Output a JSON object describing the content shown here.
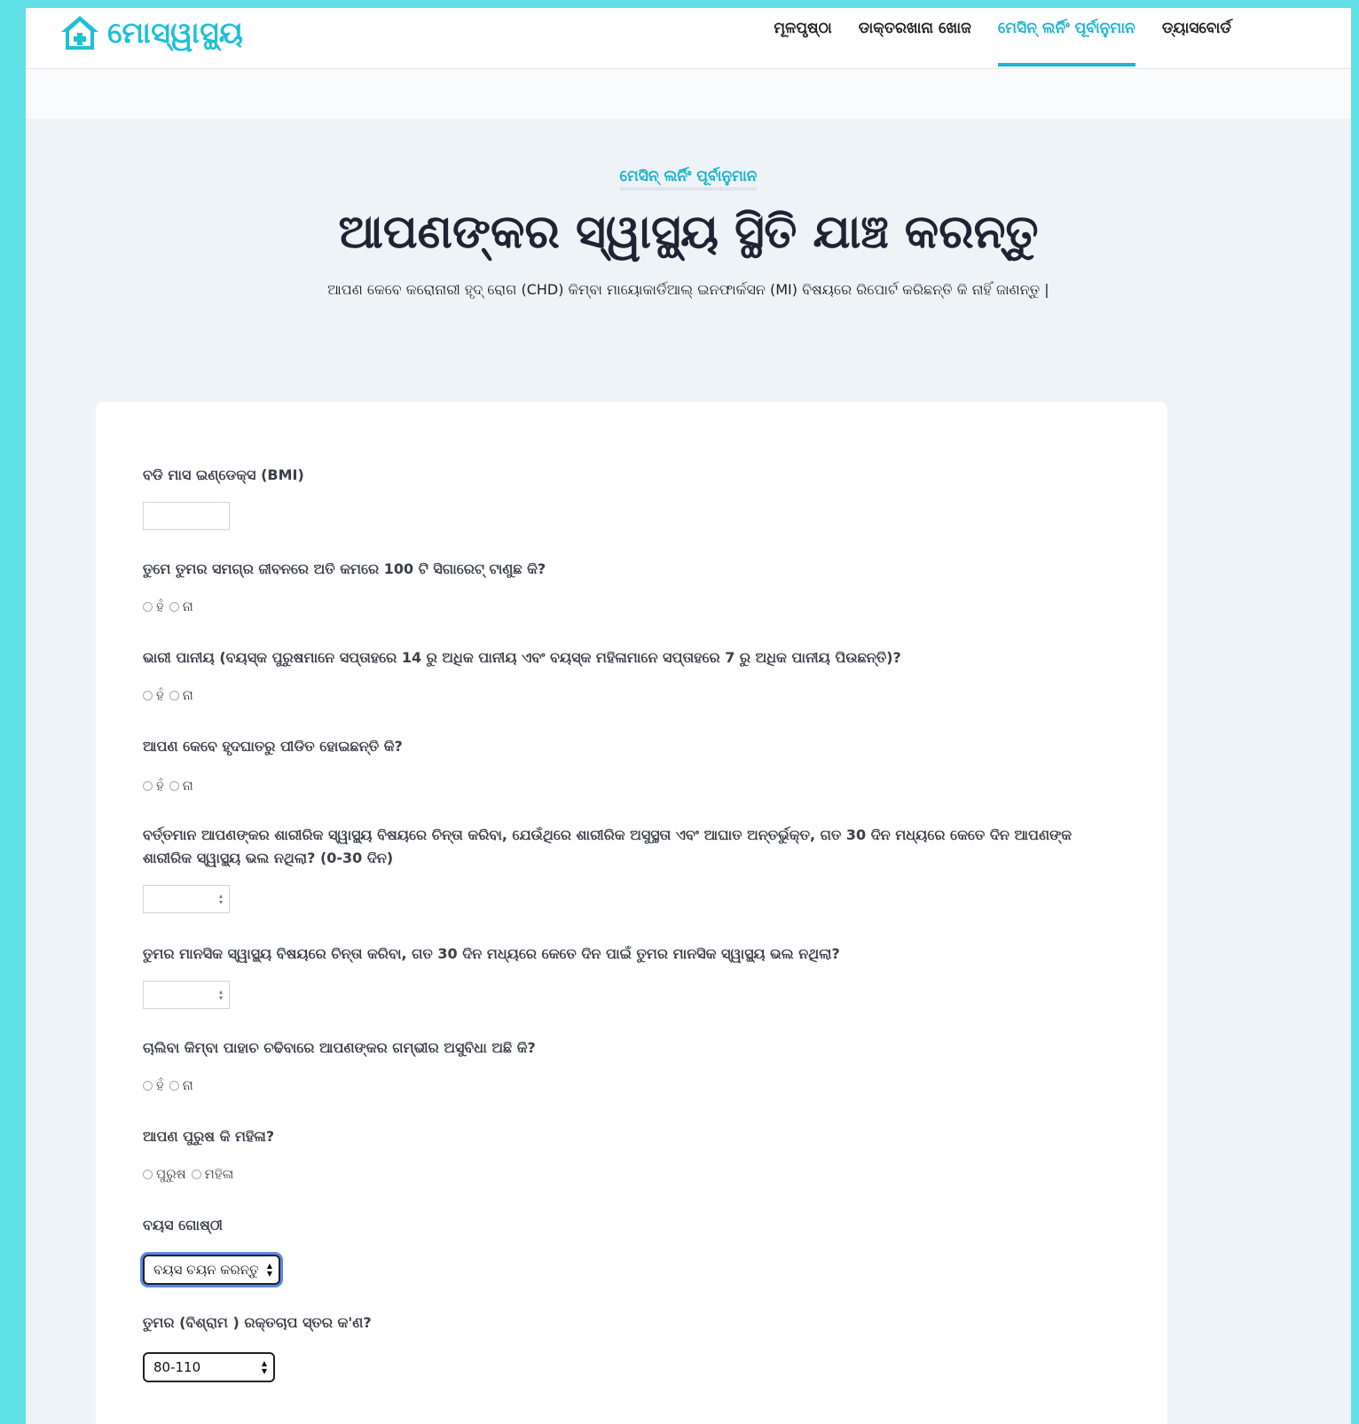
{
  "brand": {
    "name": "ମୋସ୍ୱାସ୍ଥ୍ୟ",
    "color": "#1cc0d8",
    "icon": "home-icon"
  },
  "nav": {
    "items": [
      {
        "label": "ମୂଳପୃଷ୍ଠା"
      },
      {
        "label": "ଡାକ୍ତରଖାନା ଖୋଜ"
      },
      {
        "label": "ମେସିନ୍ ଲର୍ନିଂ ପୂର୍ବାନୁମାନ",
        "active": true
      },
      {
        "label": "ଡ୍ୟାସବୋର୍ଡ"
      }
    ]
  },
  "hero": {
    "eyebrow": "ମେସିନ୍ ଲର୍ନିଂ ପୂର୍ବାନୁମାନ",
    "title": "ଆପଣଙ୍କର ସ୍ୱାସ୍ଥ୍ୟ ସ୍ଥିତି ଯାଞ୍ଚ କରନ୍ତୁ",
    "subtitle": "ଆପଣ କେବେ କରୋନାରୀ ହୃଦ୍ ରୋଗ (CHD) କିମ୍ବା ମାୟୋକାର୍ଡିଆଲ୍ ଇନଫାର୍କସନ (MI) ବିଷୟରେ ରିପୋର୍ଟ କରିଛନ୍ତି କି ନାହିଁ ଜାଣନ୍ତୁ |"
  },
  "form": {
    "bmi": {
      "label": "ବଡି ମାସ ଇଣ୍ଡେକ୍ସ (BMI)",
      "value": ""
    },
    "smoke": {
      "label": "ତୁମେ ତୁମର ସମଗ୍ର ଜୀବନରେ ଅତି କମରେ 100 ଟି ସିଗାରେଟ୍ ଟାଣୁଛ କି?",
      "yes": "ହଁ",
      "no": "ନା"
    },
    "alcohol": {
      "label": "ଭାରୀ ପାନୀୟ (ବୟସ୍କ ପୁରୁଷମାନେ ସପ୍ତାହରେ 14 ରୁ ଅଧିକ ପାନୀୟ ଏବଂ ବୟସ୍କ ମହିଳାମାନେ ସପ୍ତାହରେ 7 ରୁ ଅଧିକ ପାନୀୟ ପିଉଛନ୍ତି)?",
      "yes": "ହଁ",
      "no": "ନା"
    },
    "stroke": {
      "label": "ଆପଣ କେବେ ହୃଦଘାତରୁ ପୀଡିତ ହୋଇଛନ୍ତି କି?",
      "yes": "ହଁ",
      "no": "ନା"
    },
    "physical_health": {
      "label": "ବର୍ତ୍ତମାନ ଆପଣଙ୍କର ଶାରୀରିକ ସ୍ୱାସ୍ଥ୍ୟ ବିଷୟରେ ଚିନ୍ତା କରିବା, ଯେଉଁଥିରେ ଶାରୀରିକ ଅସୁସ୍ଥତା ଏବଂ ଆଘାତ ଅନ୍ତର୍ଭୁକ୍ତ, ଗତ 30 ଦିନ ମଧ୍ୟରେ କେତେ ଦିନ ଆପଣଙ୍କ ଶାରୀରିକ ସ୍ୱାସ୍ଥ୍ୟ ଭଲ ନଥିଲା? (0-30 ଦିନ)",
      "value": ""
    },
    "mental_health": {
      "label": "ତୁମର ମାନସିକ ସ୍ୱାସ୍ଥ୍ୟ ବିଷୟରେ ଚିନ୍ତା କରିବା, ଗତ 30 ଦିନ ମଧ୍ୟରେ କେତେ ଦିନ ପାଇଁ ତୁମର ମାନସିକ ସ୍ୱାସ୍ଥ୍ୟ ଭଲ ନଥିଲା?",
      "value": ""
    },
    "diff_walking": {
      "label": "ଚାଲିବା କିମ୍ବା ପାହାଚ ଚଢିବାରେ ଆପଣଙ୍କର ଗମ୍ଭୀର ଅସୁବିଧା ଅଛି କି?",
      "yes": "ହଁ",
      "no": "ନା"
    },
    "sex": {
      "label": "ଆପଣ ପୁରୁଷ କି ମହିଳା?",
      "male": "ପୁରୁଷ",
      "female": "ମହିଳା"
    },
    "age": {
      "label": "ବୟସ ଗୋଷ୍ଠୀ",
      "selected": "ବୟସ ଚୟନ କରନ୍ତୁ"
    },
    "bp": {
      "label": "ତୁମର (ବିଶ୍ରାମ ) ରକ୍ତଚାପ ସ୍ତର କ'ଣ?",
      "selected": "80-110"
    }
  },
  "colors": {
    "accent": "#1cb4cf",
    "frame": "#5ee0e6",
    "background": "#eef3f7"
  }
}
